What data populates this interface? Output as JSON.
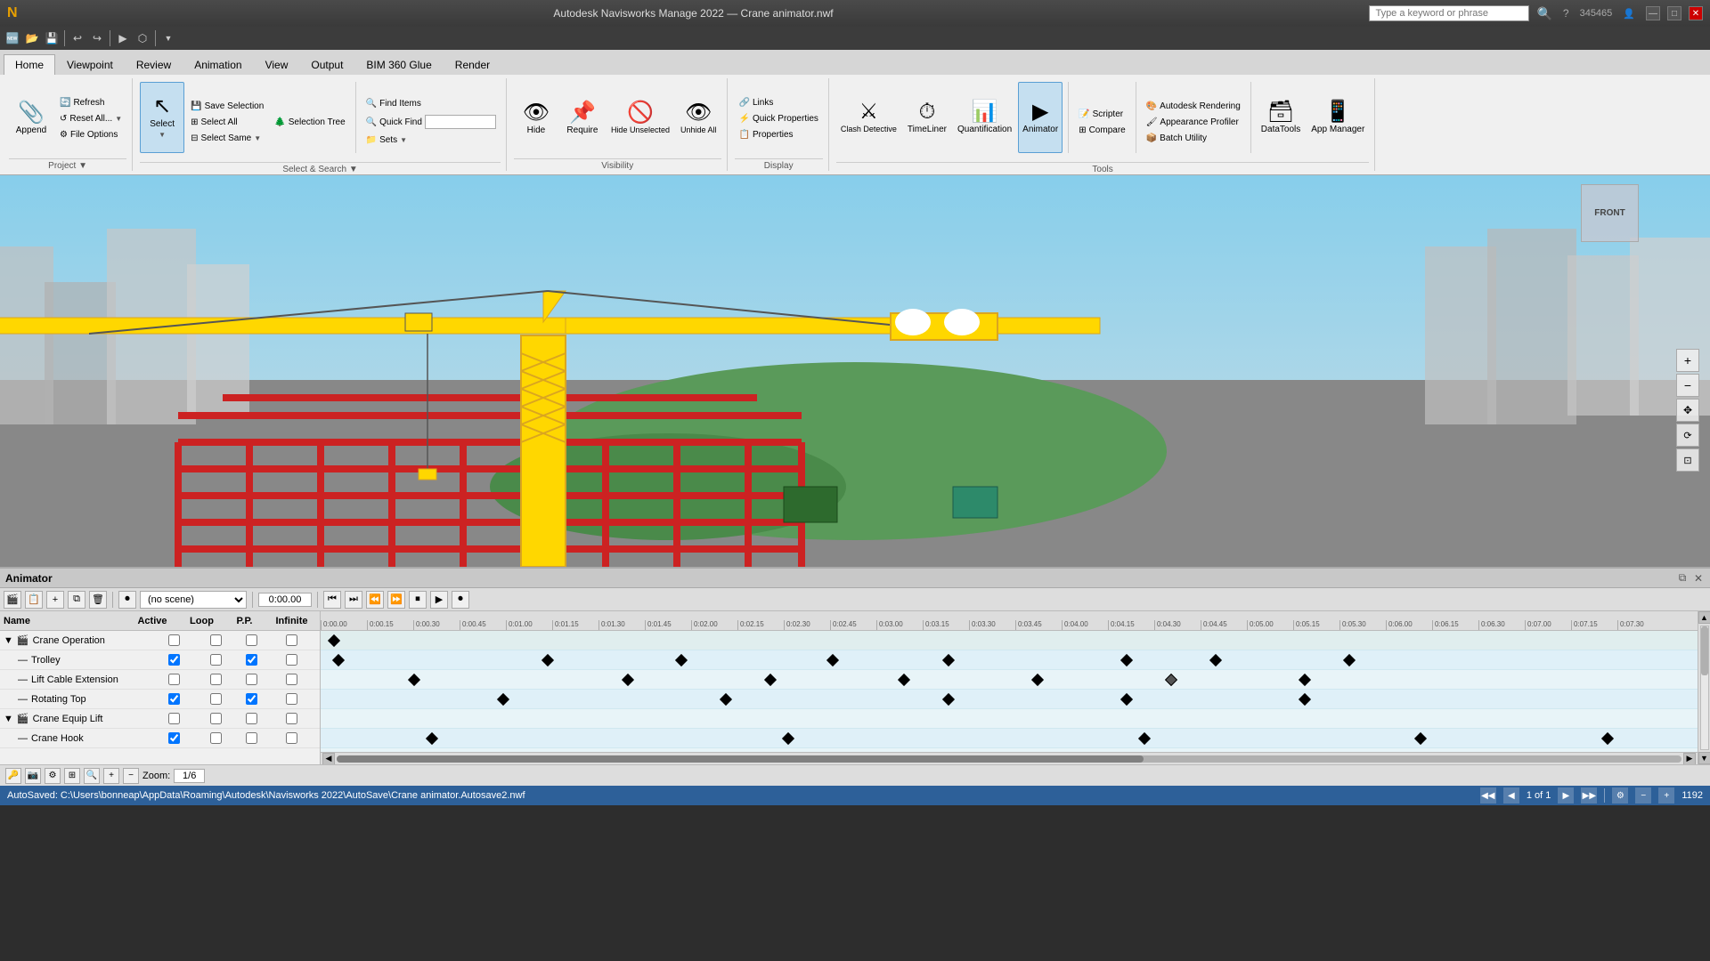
{
  "title_bar": {
    "app_title": "Autodesk Navisworks Manage 2022  —  Crane animator.nwf",
    "search_placeholder": "Type a keyword or phrase",
    "user_id": "345465",
    "min_label": "—",
    "max_label": "□",
    "close_label": "✕"
  },
  "quick_access": {
    "buttons": [
      "🆕",
      "📂",
      "💾",
      "↩",
      "↪",
      "▶",
      "⬡"
    ]
  },
  "ribbon": {
    "tabs": [
      "Home",
      "Viewpoint",
      "Review",
      "Animation",
      "View",
      "Output",
      "BIM 360 Glue",
      "Render"
    ],
    "active_tab": "Home",
    "groups": {
      "project": {
        "label": "Project",
        "buttons": [
          {
            "id": "append",
            "label": "Append",
            "icon": "📎",
            "type": "large"
          },
          {
            "id": "refresh",
            "label": "Refresh",
            "icon": "🔄",
            "type": "small"
          },
          {
            "id": "reset-all",
            "label": "Reset All...",
            "icon": "↺",
            "type": "small"
          },
          {
            "id": "file-options",
            "label": "File Options",
            "icon": "⚙",
            "type": "small"
          }
        ]
      },
      "select_search": {
        "label": "Select & Search",
        "buttons": [
          {
            "id": "select",
            "label": "Select",
            "icon": "↖",
            "type": "large",
            "active": true
          },
          {
            "id": "save-selection",
            "label": "Save Selection",
            "icon": "💾",
            "type": "small"
          },
          {
            "id": "select-all",
            "label": "Select All",
            "icon": "⊞",
            "type": "small"
          },
          {
            "id": "select-same",
            "label": "Select Same",
            "icon": "⊟",
            "type": "small"
          },
          {
            "id": "selection-tree",
            "label": "Selection Tree",
            "icon": "🌲",
            "type": "small"
          },
          {
            "id": "find-items",
            "label": "Find Items",
            "icon": "🔍",
            "type": "small"
          },
          {
            "id": "quick-find",
            "label": "Quick Find",
            "icon": "🔍",
            "type": "small"
          },
          {
            "id": "sets",
            "label": "Sets",
            "icon": "📁",
            "type": "small"
          }
        ]
      },
      "visibility": {
        "label": "Visibility",
        "buttons": [
          {
            "id": "hide",
            "label": "Hide",
            "icon": "👁",
            "type": "large"
          },
          {
            "id": "require",
            "label": "Require",
            "icon": "📌",
            "type": "large"
          },
          {
            "id": "hide-unselected",
            "label": "Hide Unselected",
            "icon": "🚫",
            "type": "large"
          },
          {
            "id": "unhide-all",
            "label": "Unhide All",
            "icon": "👁",
            "type": "large"
          }
        ]
      },
      "display": {
        "label": "Display",
        "buttons": [
          {
            "id": "links",
            "label": "Links",
            "icon": "🔗",
            "type": "small"
          },
          {
            "id": "quick-properties",
            "label": "Quick Properties",
            "icon": "⚡",
            "type": "small"
          },
          {
            "id": "properties",
            "label": "Properties",
            "icon": "📋",
            "type": "small"
          }
        ]
      },
      "tools": {
        "label": "Tools",
        "buttons": [
          {
            "id": "clash-detective",
            "label": "Clash Detective",
            "icon": "⚔",
            "type": "large"
          },
          {
            "id": "timeliner",
            "label": "TimeLiner",
            "icon": "⏱",
            "type": "large"
          },
          {
            "id": "quantification",
            "label": "Quantification",
            "icon": "📊",
            "type": "large"
          },
          {
            "id": "animator",
            "label": "Animator",
            "icon": "▶",
            "type": "large",
            "active": true
          },
          {
            "id": "scripter",
            "label": "Scripter",
            "icon": "📝",
            "type": "small"
          },
          {
            "id": "compare",
            "label": "Compare",
            "icon": "⊞",
            "type": "small"
          },
          {
            "id": "autodesk-rendering",
            "label": "Autodesk Rendering",
            "icon": "🎨",
            "type": "small"
          },
          {
            "id": "appearance-profiler",
            "label": "Appearance Profiler",
            "icon": "🖌",
            "type": "small"
          },
          {
            "id": "batch-utility",
            "label": "Batch Utility",
            "icon": "📦",
            "type": "small"
          },
          {
            "id": "datatools",
            "label": "DataTools",
            "icon": "🗃",
            "type": "large"
          },
          {
            "id": "app-manager",
            "label": "App Manager",
            "icon": "📱",
            "type": "large"
          }
        ]
      }
    }
  },
  "animator": {
    "title": "Animator",
    "scene_label": "(no scene)",
    "time_display": "0:00.00",
    "transport_buttons": [
      "⏮",
      "⏭",
      "⏪",
      "⏩",
      "⏹",
      "▶",
      "⏺"
    ],
    "zoom_label": "Zoom:",
    "zoom_value": "1/6",
    "scenes": [
      {
        "id": "crane-operation",
        "name": "Crane Operation",
        "indent": 0,
        "active": false,
        "loop": false,
        "pp": false,
        "infinite": false,
        "expandable": true
      },
      {
        "id": "trolley",
        "name": "Trolley",
        "indent": 1,
        "active": true,
        "loop": false,
        "pp": true,
        "infinite": false,
        "expandable": false
      },
      {
        "id": "lift-cable-extension",
        "name": "Lift Cable Extension",
        "indent": 1,
        "active": false,
        "loop": false,
        "pp": false,
        "infinite": false,
        "expandable": false
      },
      {
        "id": "rotating-top",
        "name": "Rotating Top",
        "indent": 1,
        "active": true,
        "loop": false,
        "pp": true,
        "infinite": false,
        "expandable": false
      },
      {
        "id": "crane-equip-lift",
        "name": "Crane Equip Lift",
        "indent": 0,
        "active": false,
        "loop": false,
        "pp": false,
        "infinite": false,
        "expandable": true
      },
      {
        "id": "crane-hook",
        "name": "Crane Hook",
        "indent": 1,
        "active": true,
        "loop": false,
        "pp": false,
        "infinite": false,
        "expandable": false
      }
    ],
    "timeline": {
      "ruler_ticks": [
        "0:00.00",
        "0:00.15",
        "0:00.30",
        "0:00.45",
        "0:01.00",
        "0:01.15",
        "0:01.30",
        "0:01.45",
        "0:02.00",
        "0:02.15",
        "0:02.30",
        "0:02.45",
        "0:03.00",
        "0:03.15",
        "0:03.30",
        "0:03.45",
        "0:04.00",
        "0:04.15",
        "0:04.30",
        "0:04.45",
        "0:05.00",
        "0:05.15",
        "0:05.30",
        "0:05.45",
        "0:06.00",
        "0:06.15",
        "0:06.30",
        "0:07.00",
        "0:07.15",
        "0:07.30"
      ]
    }
  },
  "status_bar": {
    "autosave_path": "AutoSaved: C:\\Users\\bonneap\\AppData\\Roaming\\Autodesk\\Navisworks 2022\\AutoSave\\Crane animator.Autosave2.nwf",
    "page_info": "1 of 1",
    "resolution": "1192"
  }
}
